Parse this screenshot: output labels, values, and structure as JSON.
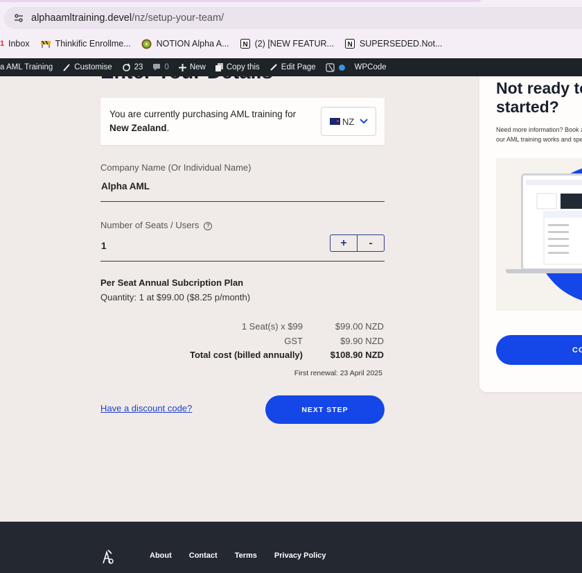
{
  "browser": {
    "url_host": "alphaamltraining.devel",
    "url_path": "/nz/setup-your-team/",
    "bookmarks": [
      "Inbox",
      "Thinkific Enrollme...",
      "NOTION Alpha A...",
      "(2) [NEW FEATUR...",
      "SUPERSEDED.Not..."
    ]
  },
  "adminbar": {
    "site": "a AML Training",
    "customise": "Customise",
    "updates": "23",
    "comments": "0",
    "new": "New",
    "copy": "Copy this",
    "edit": "Edit Page",
    "wpcode": "WPCode"
  },
  "page": {
    "heading": "Enter Your Details",
    "notice_text": "You are currently purchasing AML training for",
    "notice_country": "New Zealand",
    "country_code": "NZ"
  },
  "form": {
    "company_label": "Company Name (Or Individual Name)",
    "company_value": "Alpha AML",
    "seats_label": "Number of Seats / Users",
    "help_glyph": "?",
    "seats_value": "1",
    "plus": "+",
    "minus": "-"
  },
  "plan": {
    "title": "Per Seat Annual Subcription Plan",
    "quantity": "Quantity: 1 at $99.00 ($8.25 p/month)"
  },
  "costs": [
    {
      "label": "1 Seat(s) x $99",
      "value": "$99.00 NZD"
    },
    {
      "label": "GST",
      "value": "$9.90 NZD"
    },
    {
      "label": "Total cost (billed annually)",
      "value": "$108.90 NZD"
    }
  ],
  "renewal": "First renewal: 23 April 2025",
  "actions": {
    "discount": "Have a discount code?",
    "next": "NEXT STEP"
  },
  "side_card": {
    "title": "Not ready to get started?",
    "desc": "Need more information? Book a demo to see how our AML training works and speak with our team.",
    "button": "CONTACT US"
  },
  "footer": {
    "links": [
      "About",
      "Contact",
      "Terms",
      "Privacy Policy"
    ]
  },
  "colors": {
    "accent": "#1446e8",
    "background": "#f0ebe8",
    "footer": "#232831"
  }
}
